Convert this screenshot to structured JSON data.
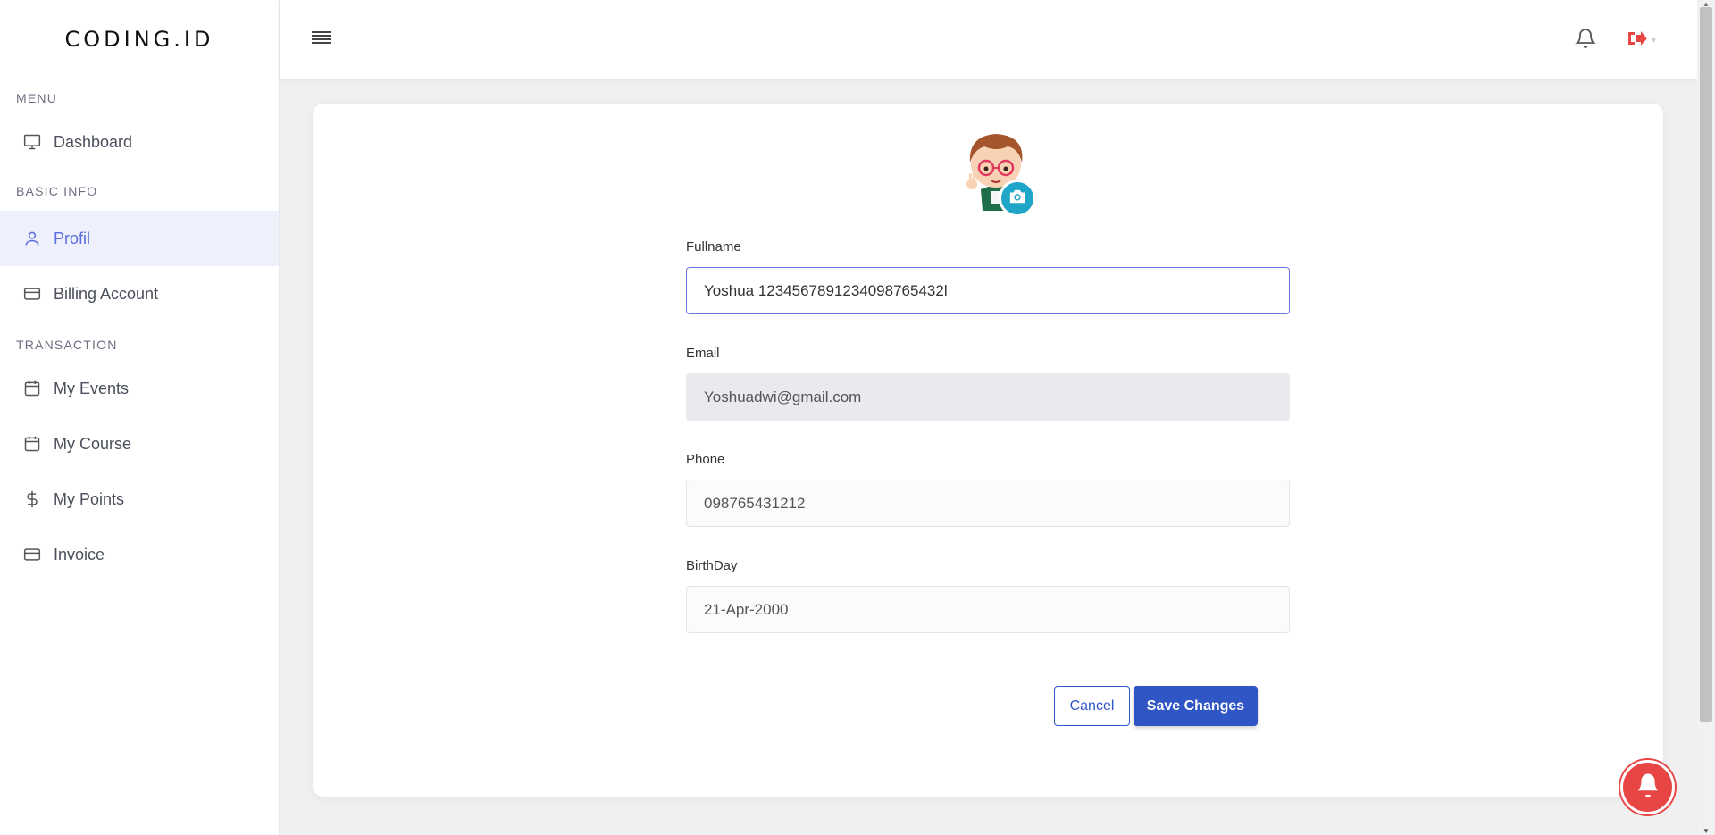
{
  "brand": "CODING.ID",
  "sidebar": {
    "sections": [
      {
        "heading": "MENU",
        "items": [
          {
            "label": "Dashboard",
            "icon": "monitor-icon"
          }
        ]
      },
      {
        "heading": "BASIC INFO",
        "items": [
          {
            "label": "Profil",
            "icon": "user-icon",
            "active": true
          },
          {
            "label": "Billing Account",
            "icon": "credit-card-icon"
          }
        ]
      },
      {
        "heading": "TRANSACTION",
        "items": [
          {
            "label": "My Events",
            "icon": "calendar-icon"
          },
          {
            "label": "My Course",
            "icon": "calendar-icon"
          },
          {
            "label": "My Points",
            "icon": "dollar-icon"
          },
          {
            "label": "Invoice",
            "icon": "credit-card-icon"
          }
        ]
      }
    ]
  },
  "topbar": {
    "menu_icon": "hamburger-icon",
    "notification_icon": "bell-icon",
    "logout_icon": "logout-icon"
  },
  "form": {
    "fullname": {
      "label": "Fullname",
      "value": "Yoshua 1234567891234098765432l"
    },
    "email": {
      "label": "Email",
      "value": "Yoshuadwi@gmail.com"
    },
    "phone": {
      "label": "Phone",
      "value": "098765431212"
    },
    "birthday": {
      "label": "BirthDay",
      "value": "21-Apr-2000"
    }
  },
  "buttons": {
    "cancel": "Cancel",
    "save": "Save Changes"
  },
  "colors": {
    "accent": "#5a6ee0",
    "primary": "#2f56c4",
    "camera": "#1ea5c8",
    "alert": "#e84545"
  }
}
